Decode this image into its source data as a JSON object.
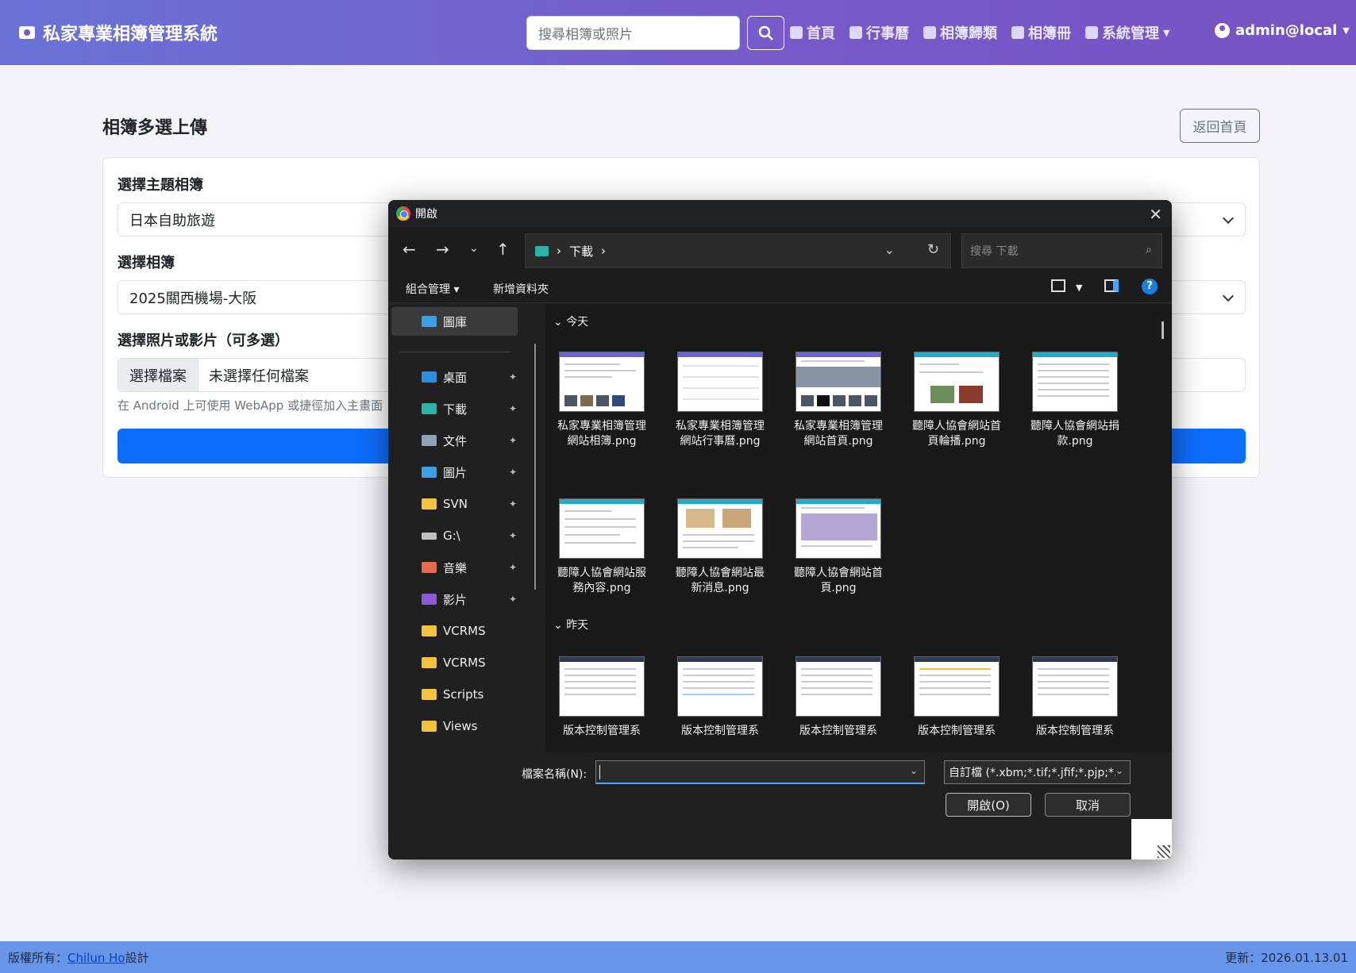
{
  "navbar": {
    "brand": "私家專業相簿管理系統",
    "search_placeholder": "搜尋相簿或照片",
    "links": [
      "首頁",
      "行事曆",
      "相簿歸類",
      "相簿冊",
      "系統管理"
    ],
    "user": "admin@local"
  },
  "page": {
    "title": "相簿多選上傳",
    "back_button": "返回首頁",
    "theme_label": "選擇主題相簿",
    "theme_value": "日本自助旅遊",
    "album_label": "選擇相簿",
    "album_value": "2025關西機場-大阪",
    "files_label": "選擇照片或影片（可多選）",
    "choose_file": "選擇檔案",
    "no_file": "未選擇任何檔案",
    "hint": "在 Android 上可使用 WebApp 或捷徑加入主畫面"
  },
  "footer": {
    "copyright_prefix": "版權所有：",
    "author_link": "Chilun Ho",
    "copyright_suffix": "設計",
    "updated": "更新：2026.01.13.01"
  },
  "dialog": {
    "title": "開啟",
    "address_crumb": "下載",
    "search_placeholder": "搜尋 下載",
    "organize": "組合管理",
    "new_folder": "新增資料夾",
    "nav_items": [
      {
        "label": "圖庫",
        "color": "#3aa0e6"
      },
      {
        "label": "桌面",
        "color": "#2f8de0"
      },
      {
        "label": "下載",
        "color": "#2bb3a5"
      },
      {
        "label": "文件",
        "color": "#8fa3b8"
      },
      {
        "label": "圖片",
        "color": "#3aa0e6"
      },
      {
        "label": "SVN",
        "color": "#f3c33a"
      },
      {
        "label": "G:\\",
        "color": "#c0c0c0"
      },
      {
        "label": "音樂",
        "color": "#e86a4c"
      },
      {
        "label": "影片",
        "color": "#8e5ad8"
      },
      {
        "label": "VCRMS",
        "color": "#f3c33a"
      },
      {
        "label": "VCRMS",
        "color": "#f3c33a"
      },
      {
        "label": "Scripts",
        "color": "#f3c33a"
      },
      {
        "label": "Views",
        "color": "#f3c33a"
      }
    ],
    "group_today": "今天",
    "group_yesterday": "昨天",
    "files_today": [
      "私家專業相簿管理網站相簿.png",
      "私家專業相簿管理網站行事曆.png",
      "私家專業相簿管理網站首頁.png",
      "聽障人協會網站首頁輪播.png",
      "聽障人協會網站捐款.png",
      "聽障人協會網站服務內容.png",
      "聽障人協會網站最新消息.png",
      "聽障人協會網站首頁.png"
    ],
    "files_yesterday": [
      "版本控制管理系",
      "版本控制管理系",
      "版本控制管理系",
      "版本控制管理系",
      "版本控制管理系"
    ],
    "filename_label": "檔案名稱(N):",
    "filename_value": "",
    "filetype": "自訂檔 (*.xbm;*.tif;*.jfif;*.pjp;*.a",
    "open_button": "開啟(O)",
    "cancel_button": "取消"
  }
}
